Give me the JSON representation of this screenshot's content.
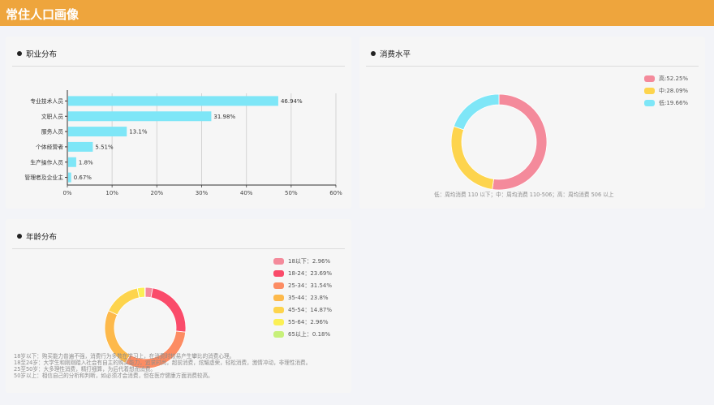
{
  "header": {
    "title": "常住人口画像"
  },
  "cards": {
    "occupation": {
      "title": "职业分布"
    },
    "consumption": {
      "title": "消费水平",
      "note": "低：周均消费 110 以下；中：周均消费 110-506；高：周均消费 506 以上",
      "legend": [
        {
          "label": "高:52.25%",
          "color": "#f48a9b"
        },
        {
          "label": "中:28.09%",
          "color": "#fdd44d"
        },
        {
          "label": "低:19.66%",
          "color": "#7ee6f7"
        }
      ]
    },
    "age": {
      "title": "年龄分布",
      "legend": [
        {
          "label": "18以下：2.96%",
          "color": "#f48a9b"
        },
        {
          "label": "18-24：23.69%",
          "color": "#fa4b6a"
        },
        {
          "label": "25-34：31.54%",
          "color": "#fc8c63"
        },
        {
          "label": "35-44：23.8%",
          "color": "#fdb94b"
        },
        {
          "label": "45-54：14.87%",
          "color": "#fdd44d"
        },
        {
          "label": "55-64：2.96%",
          "color": "#fbf055"
        },
        {
          "label": "65以上：0.18%",
          "color": "#c7f07a"
        }
      ],
      "notes": [
        "18岁以下：购买能力普遍不强，消费行为多数在学习上，在消费时较易产生攀比的消费心理。",
        "18至24岁：大学生和刚刚踏入社会有自主的购买能力，追求时尚，超前消费，炫耀虚荣，轻松消费，激情冲动，非理性消费。",
        "25至50岁：大多理性消费，精打细算，为后代着想而消费。",
        "50岁以上：相信自己的分析和判断，如必须才会消费，但在医疗健康方面消费较高。"
      ]
    }
  },
  "chart_data": [
    {
      "type": "bar",
      "orientation": "horizontal",
      "title": "职业分布",
      "categories": [
        "专业技术人员",
        "文职人员",
        "服务人员",
        "个体经营者",
        "生产操作人员",
        "管理者及企业主"
      ],
      "values": [
        46.94,
        31.98,
        13.1,
        5.51,
        1.8,
        0.67
      ],
      "data_labels": [
        "46.94%",
        "31.98%",
        "13.1%",
        "5.51%",
        "1.8%",
        "0.67%"
      ],
      "xlim": [
        0,
        60
      ],
      "xticks": [
        "0%",
        "10%",
        "20%",
        "30%",
        "40%",
        "50%",
        "60%"
      ],
      "grid": true,
      "color": "#7ee6f7"
    },
    {
      "type": "pie",
      "donut": true,
      "title": "消费水平",
      "categories": [
        "高",
        "中",
        "低"
      ],
      "values": [
        52.25,
        28.09,
        19.66
      ],
      "colors": [
        "#f48a9b",
        "#fdd44d",
        "#7ee6f7"
      ],
      "legend": "top-right"
    },
    {
      "type": "pie",
      "donut": true,
      "title": "年龄分布",
      "categories": [
        "18以下",
        "18-24",
        "25-34",
        "35-44",
        "45-54",
        "55-64",
        "65以上"
      ],
      "values": [
        2.96,
        23.69,
        31.54,
        23.8,
        14.87,
        2.96,
        0.18
      ],
      "colors": [
        "#f48a9b",
        "#fa4b6a",
        "#fc8c63",
        "#fdb94b",
        "#fdd44d",
        "#fbf055",
        "#c7f07a"
      ],
      "legend": "right"
    }
  ]
}
